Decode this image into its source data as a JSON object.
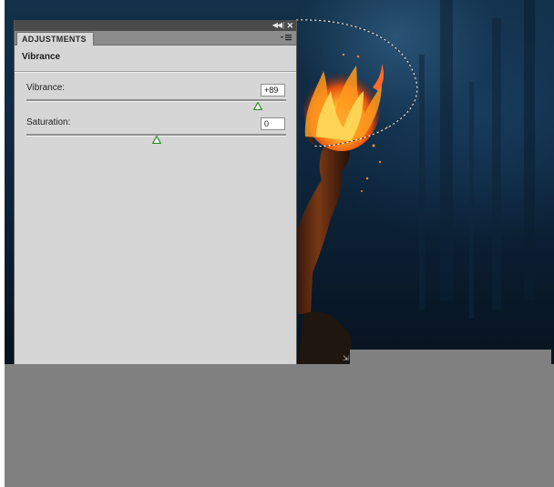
{
  "panel": {
    "tab_label": "ADJUSTMENTS",
    "title": "Vibrance",
    "collapse_icon": "double-chevron-left-icon",
    "close_icon": "close-icon",
    "menu_icon": "panel-menu-icon"
  },
  "vibrance": {
    "label": "Vibrance:",
    "value": "+89",
    "level": 0.89
  },
  "saturation": {
    "label": "Saturation:",
    "value": "0",
    "level": 0.5
  },
  "colors": {
    "panel_bg": "#d6d6d6",
    "topbar": "#4a4a4a",
    "workspace_gray": "#808080",
    "slider_thumb": "#2f8a2f"
  }
}
